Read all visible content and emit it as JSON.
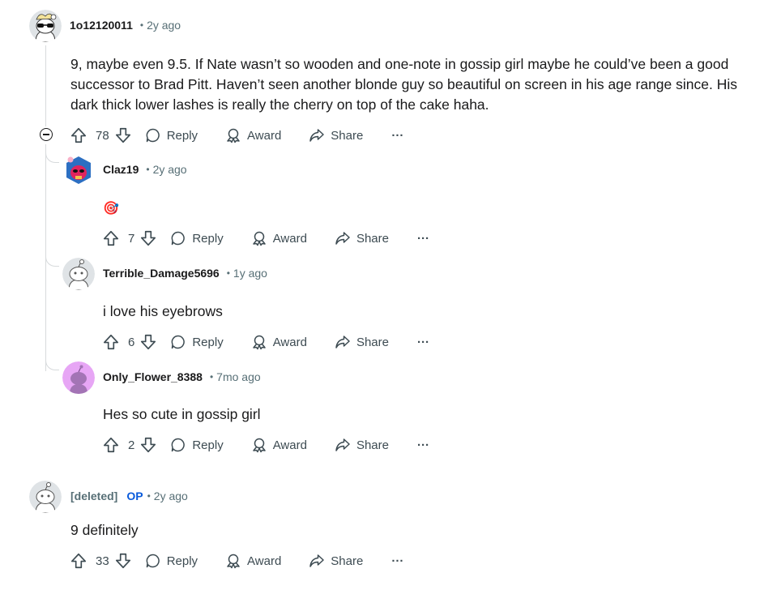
{
  "comments": [
    {
      "username": "1o12120011",
      "time": "2y ago",
      "body": "9, maybe even 9.5. If Nate wasn’t so wooden and one-note in gossip girl maybe he could’ve been a good successor to Brad Pitt. Haven’t seen another blonde guy so beautiful on screen in his age range since. His dark thick lower lashes is really the cherry on top of the cake haha.",
      "votes": "78",
      "replies": [
        {
          "username": "Claz19",
          "time": "2y ago",
          "body": "🎯",
          "votes": "7"
        },
        {
          "username": "Terrible_Damage5696",
          "time": "1y ago",
          "body": "i love his eyebrows",
          "votes": "6"
        },
        {
          "username": "Only_Flower_8388",
          "time": "7mo ago",
          "body": "Hes so cute in gossip girl",
          "votes": "2"
        }
      ]
    },
    {
      "username": "[deleted]",
      "badge": "OP",
      "time": "2y ago",
      "body": "9 definitely",
      "votes": "33"
    }
  ],
  "actions": {
    "reply": "Reply",
    "award": "Award",
    "share": "Share",
    "more": "···",
    "separator": "•"
  },
  "icons": [
    "upvote-icon",
    "downvote-icon",
    "reply-icon",
    "award-icon",
    "share-icon",
    "more-icon",
    "collapse-icon"
  ]
}
